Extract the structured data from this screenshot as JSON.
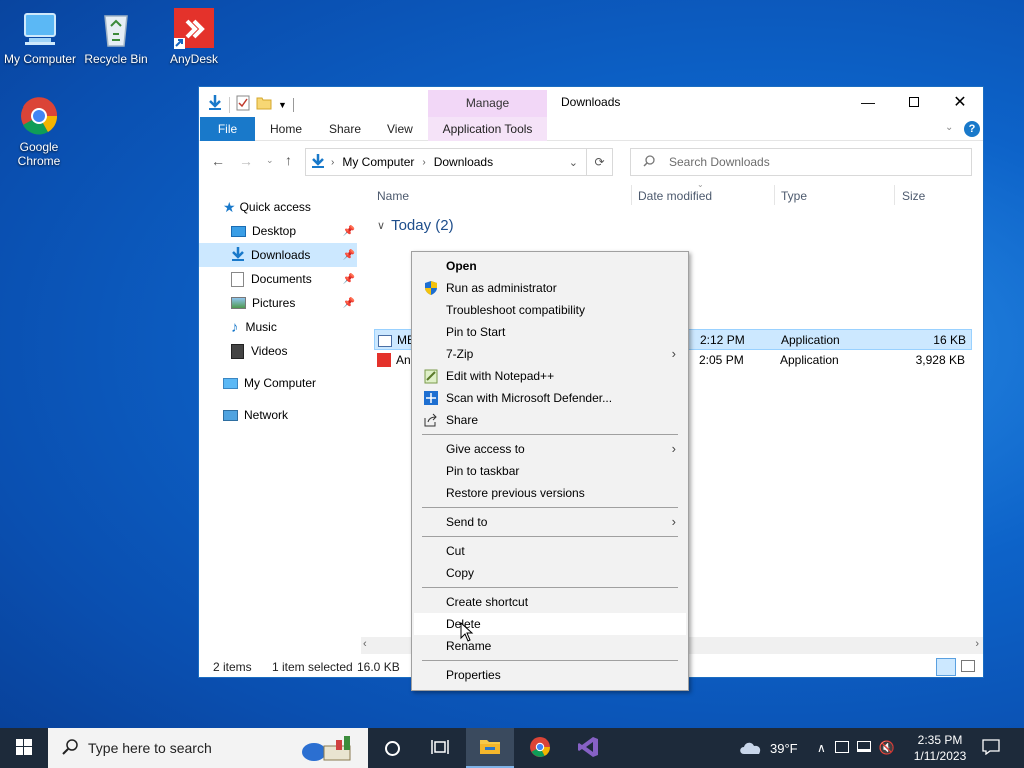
{
  "desktop": {
    "icons": [
      {
        "label": "My Computer"
      },
      {
        "label": "Recycle Bin"
      },
      {
        "label": "AnyDesk"
      },
      {
        "label": "Google Chrome"
      }
    ]
  },
  "window": {
    "title": "Downloads",
    "manage_tab": "Manage",
    "ribbon_tabs": {
      "file": "File",
      "home": "Home",
      "share": "Share",
      "view": "View",
      "app_tools": "Application Tools"
    },
    "help": "?"
  },
  "nav": {
    "breadcrumb": [
      "My Computer",
      "Downloads"
    ],
    "search_placeholder": "Search Downloads"
  },
  "sidebar": {
    "quick_access": "Quick access",
    "items": [
      {
        "label": "Desktop"
      },
      {
        "label": "Downloads"
      },
      {
        "label": "Documents"
      },
      {
        "label": "Pictures"
      },
      {
        "label": "Music"
      },
      {
        "label": "Videos"
      }
    ],
    "my_computer": "My Computer",
    "network": "Network"
  },
  "columns": {
    "name": "Name",
    "date": "Date modified",
    "type": "Type",
    "size": "Size"
  },
  "group": {
    "label": "Today (2)"
  },
  "files": [
    {
      "name": "MEMZ",
      "date": "1/11/2023 2:12 PM",
      "type": "Application",
      "size": "16 KB"
    },
    {
      "name": "AnyDesk",
      "date": "1/11/2023 2:05 PM",
      "type": "Application",
      "size": "3,928 KB"
    }
  ],
  "visible": {
    "row0_name": "MEMZ",
    "row0_date_tail": "2:12 PM",
    "row1_name": "An",
    "row1_date_tail": "2:05 PM"
  },
  "status": {
    "items": "2 items",
    "selected": "1 item selected",
    "size": "16.0 KB"
  },
  "context_menu": {
    "open": "Open",
    "run_admin": "Run as administrator",
    "troubleshoot": "Troubleshoot compatibility",
    "pin_start": "Pin to Start",
    "zip": "7-Zip",
    "notepad": "Edit with Notepad++",
    "defender": "Scan with Microsoft Defender...",
    "share": "Share",
    "give_access": "Give access to",
    "pin_taskbar": "Pin to taskbar",
    "restore": "Restore previous versions",
    "send_to": "Send to",
    "cut": "Cut",
    "copy": "Copy",
    "create_shortcut": "Create shortcut",
    "delete": "Delete",
    "rename": "Rename",
    "properties": "Properties"
  },
  "taskbar": {
    "search_placeholder": "Type here to search",
    "weather": "39°F",
    "time": "2:35 PM",
    "date": "1/11/2023"
  },
  "colors": {
    "accent": "#1979ca",
    "selection": "#cce8ff",
    "manage_tab": "#f2d7f7",
    "taskbar": "#1d2a3a"
  }
}
